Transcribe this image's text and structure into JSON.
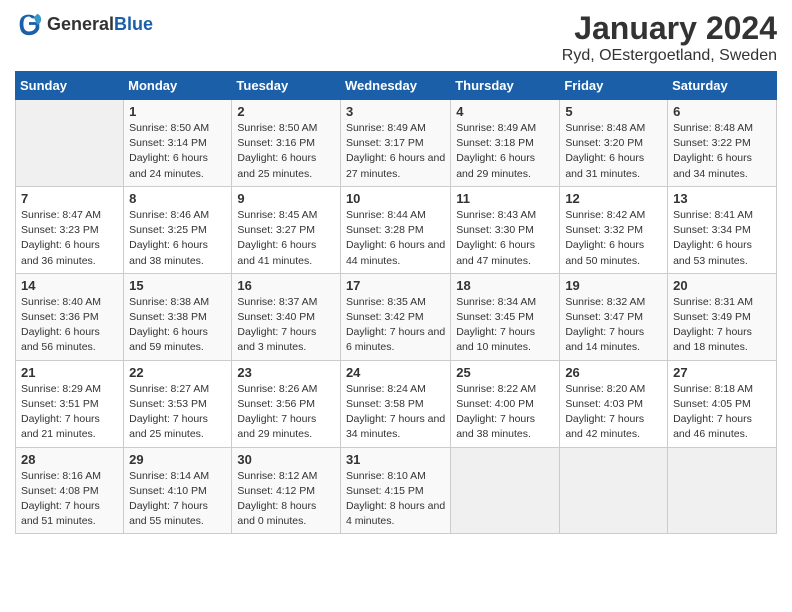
{
  "header": {
    "logo_general": "General",
    "logo_blue": "Blue",
    "title": "January 2024",
    "subtitle": "Ryd, OEstergoetland, Sweden"
  },
  "weekdays": [
    "Sunday",
    "Monday",
    "Tuesday",
    "Wednesday",
    "Thursday",
    "Friday",
    "Saturday"
  ],
  "weeks": [
    [
      {
        "day": "",
        "detail": ""
      },
      {
        "day": "1",
        "detail": "Sunrise: 8:50 AM\nSunset: 3:14 PM\nDaylight: 6 hours\nand 24 minutes."
      },
      {
        "day": "2",
        "detail": "Sunrise: 8:50 AM\nSunset: 3:16 PM\nDaylight: 6 hours\nand 25 minutes."
      },
      {
        "day": "3",
        "detail": "Sunrise: 8:49 AM\nSunset: 3:17 PM\nDaylight: 6 hours\nand 27 minutes."
      },
      {
        "day": "4",
        "detail": "Sunrise: 8:49 AM\nSunset: 3:18 PM\nDaylight: 6 hours\nand 29 minutes."
      },
      {
        "day": "5",
        "detail": "Sunrise: 8:48 AM\nSunset: 3:20 PM\nDaylight: 6 hours\nand 31 minutes."
      },
      {
        "day": "6",
        "detail": "Sunrise: 8:48 AM\nSunset: 3:22 PM\nDaylight: 6 hours\nand 34 minutes."
      }
    ],
    [
      {
        "day": "7",
        "detail": "Sunrise: 8:47 AM\nSunset: 3:23 PM\nDaylight: 6 hours\nand 36 minutes."
      },
      {
        "day": "8",
        "detail": "Sunrise: 8:46 AM\nSunset: 3:25 PM\nDaylight: 6 hours\nand 38 minutes."
      },
      {
        "day": "9",
        "detail": "Sunrise: 8:45 AM\nSunset: 3:27 PM\nDaylight: 6 hours\nand 41 minutes."
      },
      {
        "day": "10",
        "detail": "Sunrise: 8:44 AM\nSunset: 3:28 PM\nDaylight: 6 hours\nand 44 minutes."
      },
      {
        "day": "11",
        "detail": "Sunrise: 8:43 AM\nSunset: 3:30 PM\nDaylight: 6 hours\nand 47 minutes."
      },
      {
        "day": "12",
        "detail": "Sunrise: 8:42 AM\nSunset: 3:32 PM\nDaylight: 6 hours\nand 50 minutes."
      },
      {
        "day": "13",
        "detail": "Sunrise: 8:41 AM\nSunset: 3:34 PM\nDaylight: 6 hours\nand 53 minutes."
      }
    ],
    [
      {
        "day": "14",
        "detail": "Sunrise: 8:40 AM\nSunset: 3:36 PM\nDaylight: 6 hours\nand 56 minutes."
      },
      {
        "day": "15",
        "detail": "Sunrise: 8:38 AM\nSunset: 3:38 PM\nDaylight: 6 hours\nand 59 minutes."
      },
      {
        "day": "16",
        "detail": "Sunrise: 8:37 AM\nSunset: 3:40 PM\nDaylight: 7 hours\nand 3 minutes."
      },
      {
        "day": "17",
        "detail": "Sunrise: 8:35 AM\nSunset: 3:42 PM\nDaylight: 7 hours\nand 6 minutes."
      },
      {
        "day": "18",
        "detail": "Sunrise: 8:34 AM\nSunset: 3:45 PM\nDaylight: 7 hours\nand 10 minutes."
      },
      {
        "day": "19",
        "detail": "Sunrise: 8:32 AM\nSunset: 3:47 PM\nDaylight: 7 hours\nand 14 minutes."
      },
      {
        "day": "20",
        "detail": "Sunrise: 8:31 AM\nSunset: 3:49 PM\nDaylight: 7 hours\nand 18 minutes."
      }
    ],
    [
      {
        "day": "21",
        "detail": "Sunrise: 8:29 AM\nSunset: 3:51 PM\nDaylight: 7 hours\nand 21 minutes."
      },
      {
        "day": "22",
        "detail": "Sunrise: 8:27 AM\nSunset: 3:53 PM\nDaylight: 7 hours\nand 25 minutes."
      },
      {
        "day": "23",
        "detail": "Sunrise: 8:26 AM\nSunset: 3:56 PM\nDaylight: 7 hours\nand 29 minutes."
      },
      {
        "day": "24",
        "detail": "Sunrise: 8:24 AM\nSunset: 3:58 PM\nDaylight: 7 hours\nand 34 minutes."
      },
      {
        "day": "25",
        "detail": "Sunrise: 8:22 AM\nSunset: 4:00 PM\nDaylight: 7 hours\nand 38 minutes."
      },
      {
        "day": "26",
        "detail": "Sunrise: 8:20 AM\nSunset: 4:03 PM\nDaylight: 7 hours\nand 42 minutes."
      },
      {
        "day": "27",
        "detail": "Sunrise: 8:18 AM\nSunset: 4:05 PM\nDaylight: 7 hours\nand 46 minutes."
      }
    ],
    [
      {
        "day": "28",
        "detail": "Sunrise: 8:16 AM\nSunset: 4:08 PM\nDaylight: 7 hours\nand 51 minutes."
      },
      {
        "day": "29",
        "detail": "Sunrise: 8:14 AM\nSunset: 4:10 PM\nDaylight: 7 hours\nand 55 minutes."
      },
      {
        "day": "30",
        "detail": "Sunrise: 8:12 AM\nSunset: 4:12 PM\nDaylight: 8 hours\nand 0 minutes."
      },
      {
        "day": "31",
        "detail": "Sunrise: 8:10 AM\nSunset: 4:15 PM\nDaylight: 8 hours\nand 4 minutes."
      },
      {
        "day": "",
        "detail": ""
      },
      {
        "day": "",
        "detail": ""
      },
      {
        "day": "",
        "detail": ""
      }
    ]
  ]
}
